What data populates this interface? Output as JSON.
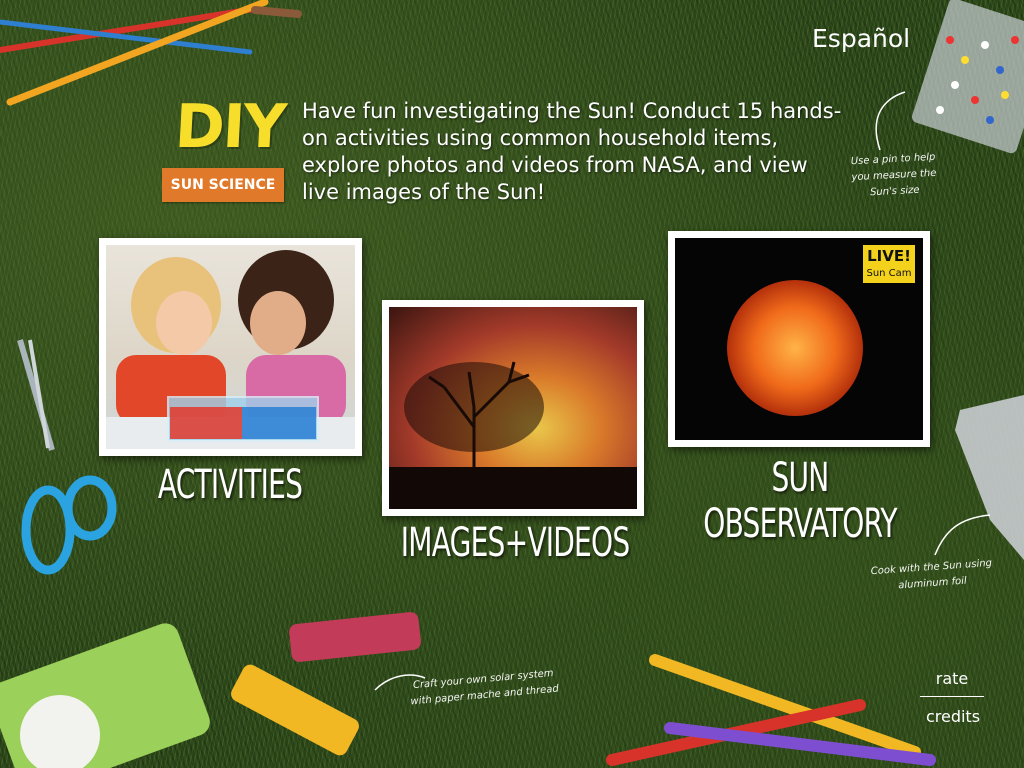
{
  "header": {
    "language_link": "Español"
  },
  "logo": {
    "title": "DIY",
    "subtitle": "SUN SCIENCE"
  },
  "intro": {
    "text": "Have fun investigating the Sun! Conduct 15 hands-on activities using common household items, explore photos and videos from NASA, and view live images of the Sun!"
  },
  "sections": {
    "activities": {
      "label": "ACTIVITIES"
    },
    "images_videos": {
      "label": "IMAGES+VIDEOS"
    },
    "sun_observatory": {
      "label": "SUN OBSERVATORY",
      "badge_title": "LIVE!",
      "badge_subtitle": "Sun Cam"
    }
  },
  "hints": {
    "pin": "Use a pin to help you measure the Sun's size",
    "cook": "Cook with the Sun using aluminum foil",
    "craft": "Craft your own solar system with paper mache and thread"
  },
  "footer": {
    "rate": "rate",
    "credits": "credits"
  },
  "colors": {
    "logo_yellow": "#f6de2a",
    "badge_orange": "#e07a2a",
    "live_yellow": "#f4d21c",
    "grass": "#2f4a1c"
  }
}
